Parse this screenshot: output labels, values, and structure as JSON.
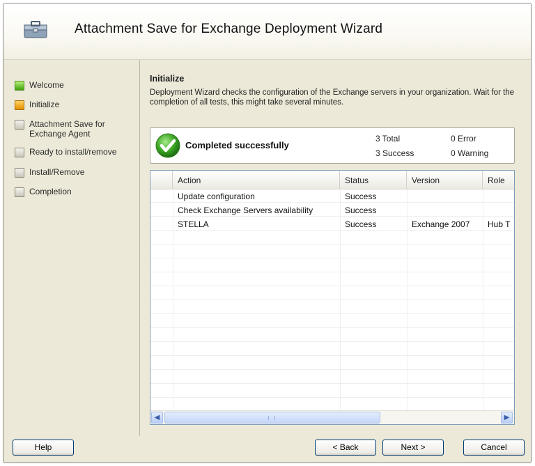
{
  "window": {
    "title": "Attachment Save for Exchange Deployment Wizard",
    "icon": "briefcase-icon"
  },
  "sidebar": {
    "steps": [
      {
        "label": "Welcome",
        "state": "done"
      },
      {
        "label": "Initialize",
        "state": "current"
      },
      {
        "label": "Attachment Save for Exchange Agent",
        "state": "pending"
      },
      {
        "label": "Ready to install/remove",
        "state": "pending"
      },
      {
        "label": "Install/Remove",
        "state": "pending"
      },
      {
        "label": "Completion",
        "state": "pending"
      }
    ]
  },
  "main": {
    "title": "Initialize",
    "description": "Deployment Wizard checks the configuration of the Exchange servers in your organization. Wait for the completion of all tests, this might take several minutes."
  },
  "status_panel": {
    "icon": "checkmark-success-icon",
    "text": "Completed successfully",
    "total": "3 Total",
    "success": "3 Success",
    "error": "0 Error",
    "warning": "0 Warning"
  },
  "grid": {
    "columns": [
      "Action",
      "Status",
      "Version",
      "Role"
    ],
    "rows": [
      {
        "action": "Update configuration",
        "status": "Success",
        "version": "",
        "role": ""
      },
      {
        "action": "Check Exchange Servers availability",
        "status": "Success",
        "version": "",
        "role": ""
      },
      {
        "action": "STELLA",
        "status": "Success",
        "version": "Exchange 2007",
        "role": "Hub T"
      }
    ]
  },
  "buttons": {
    "help": "Help",
    "back": "< Back",
    "next": "Next >",
    "cancel": "Cancel"
  },
  "colors": {
    "window_bg": "#ece9d8",
    "step_done": "#3ea20a",
    "step_current": "#e59100",
    "button_border": "#003c74"
  }
}
